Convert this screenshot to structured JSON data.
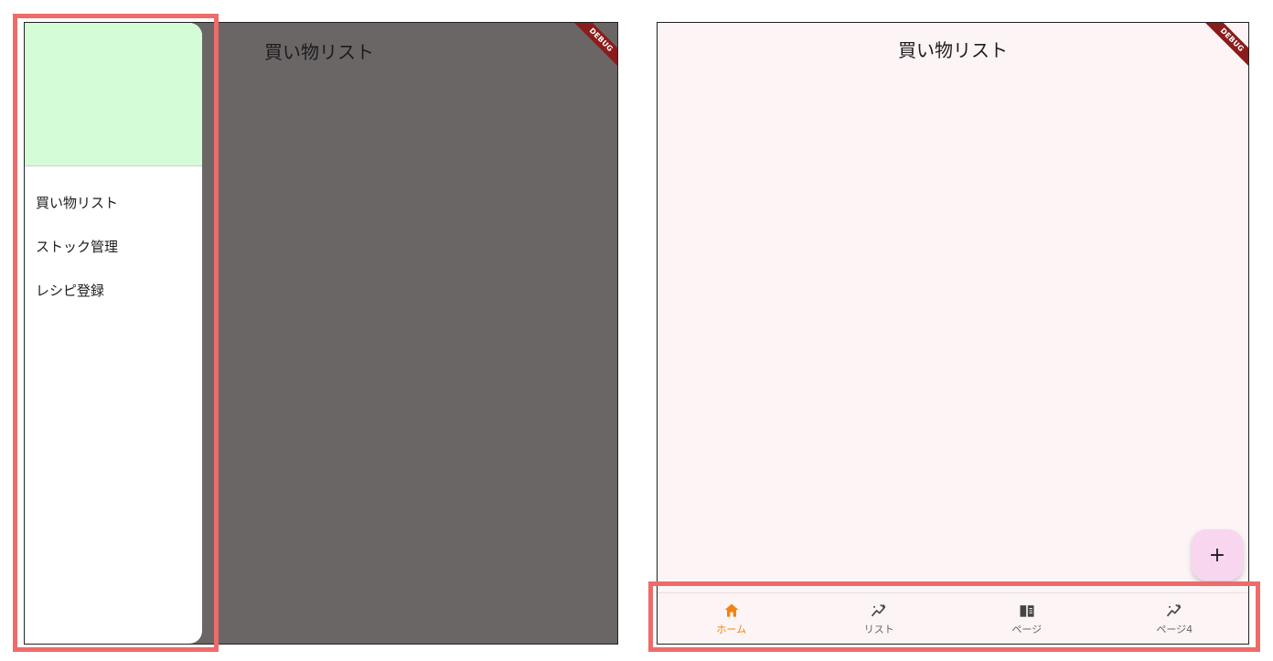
{
  "left_screen": {
    "app_title": "買い物リスト",
    "debug_banner": "DEBUG",
    "drawer": {
      "items": [
        {
          "label": "買い物リスト"
        },
        {
          "label": "ストック管理"
        },
        {
          "label": "レシピ登録"
        }
      ]
    }
  },
  "right_screen": {
    "app_title": "買い物リスト",
    "debug_banner": "DEBUG",
    "fab_label": "+",
    "bottom_nav": {
      "items": [
        {
          "label": "ホーム",
          "icon": "home-icon",
          "active": true
        },
        {
          "label": "リスト",
          "icon": "sparkline-icon",
          "active": false
        },
        {
          "label": "ページ",
          "icon": "book-icon",
          "active": false
        },
        {
          "label": "ページ4",
          "icon": "sparkline-icon",
          "active": false
        }
      ]
    }
  },
  "colors": {
    "accent": "#f2830f",
    "drawer_header": "#d4fdd7",
    "scrim": "#6a6666",
    "highlight": "#ee6b6b",
    "fab": "#f9d6ef"
  }
}
